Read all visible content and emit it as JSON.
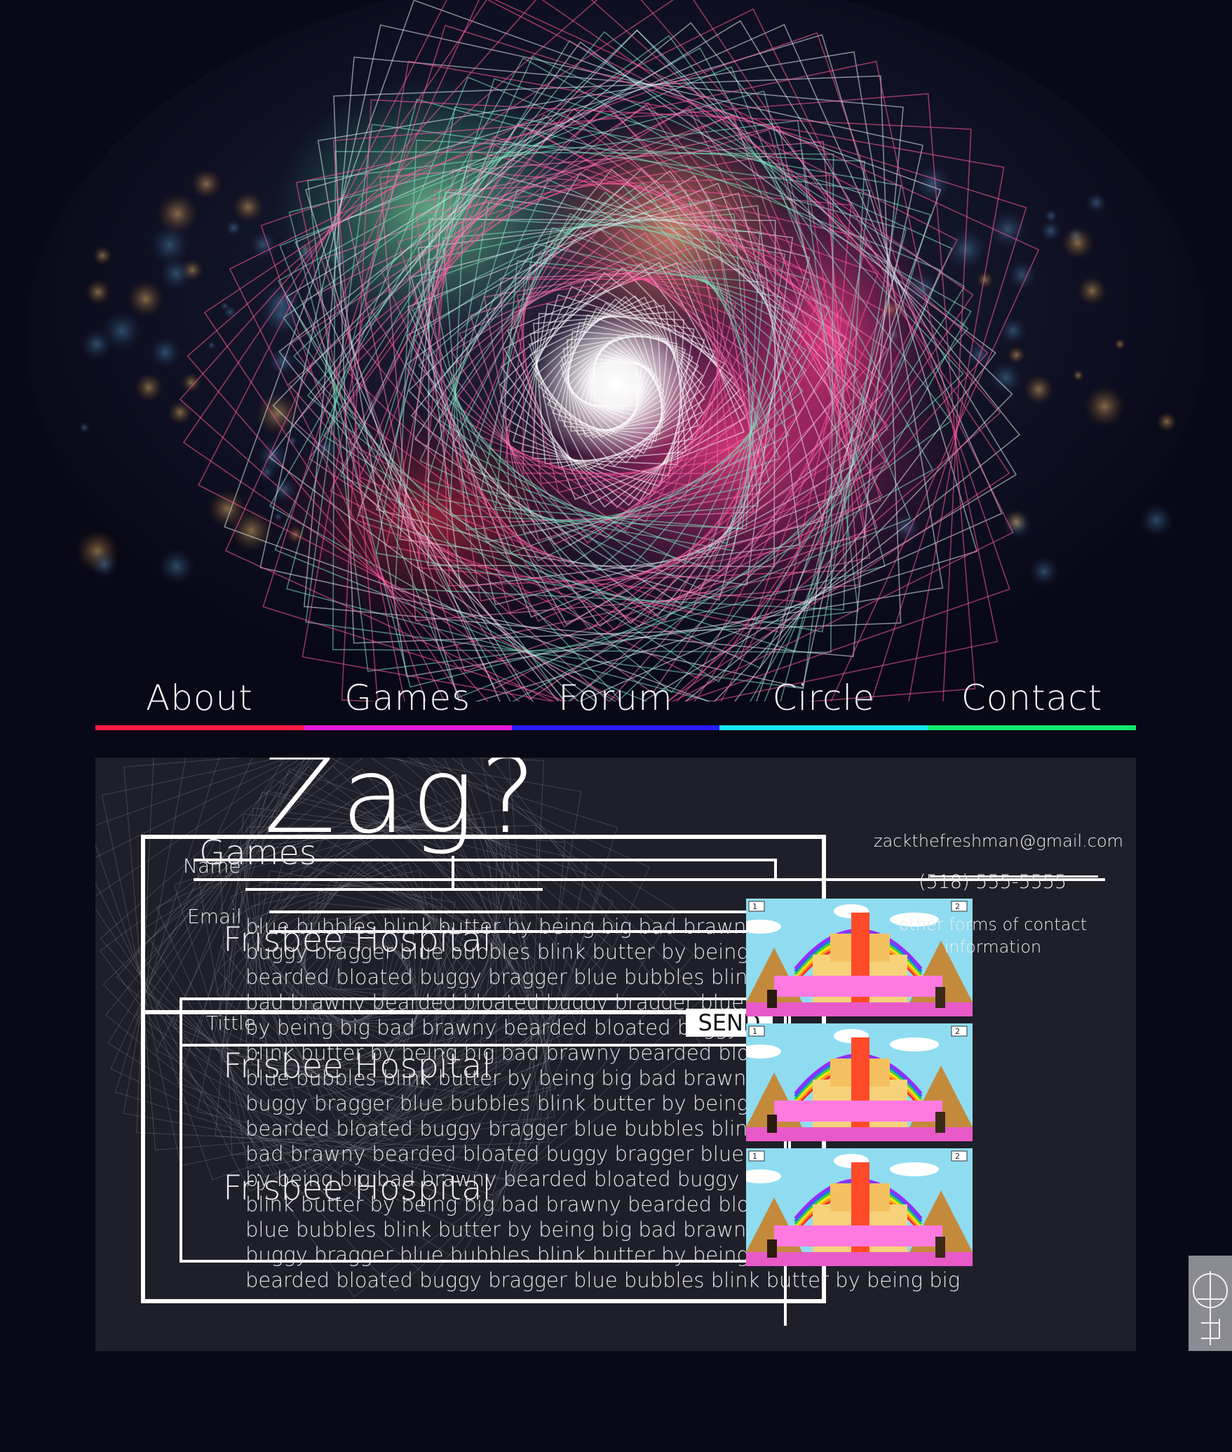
{
  "nav": {
    "items": [
      {
        "label": "About",
        "color": "#ff1a44"
      },
      {
        "label": "Games",
        "color": "#e81ad7"
      },
      {
        "label": "Forum",
        "color": "#2a1aff"
      },
      {
        "label": "Circle",
        "color": "#18e6ee"
      },
      {
        "label": "Contact",
        "color": "#12e86a"
      }
    ]
  },
  "logo": {
    "text": "Zag?"
  },
  "form": {
    "name_label": "Name",
    "email_label": "Email",
    "title_label": "Tittle",
    "send_label": "SEND"
  },
  "games": {
    "heading": "Games",
    "entries": [
      "Frisbee Hospital",
      "Frisbee Hospital",
      "Frisbee Hospital"
    ],
    "thumb_badges": [
      "1",
      "2"
    ]
  },
  "body_text": {
    "lines": [
      "blue bubbles blink butter by being big bad brawny",
      "buggy bragger blue bubbles blink butter by being",
      "bearded bloated buggy bragger blue bubbles blink",
      "bad brawny bearded bloated buggy bragger blue",
      "by being big bad brawny bearded bloated buggy",
      "blink butter by being big bad brawny bearded blo",
      "blue bubbles blink butter by being big bad brawny",
      "buggy bragger blue bubbles blink butter by being",
      "bearded bloated buggy bragger blue bubbles blink",
      "bad brawny bearded bloated buggy bragger blue",
      "by being big bad brawny bearded bloated buggy",
      "blink butter by being big bad brawny bearded blo",
      "blue bubbles blink butter by being big bad brawny",
      "buggy bragger blue bubbles blink butter by being",
      "bearded bloated buggy bragger blue bubbles blink butter by being big"
    ]
  },
  "contact": {
    "email": "zackthefreshman@gmail.com",
    "phone": "(518) 555-5555",
    "other": "other forms of contact information"
  },
  "badge": {
    "icon": "monogram-logo-icon"
  }
}
